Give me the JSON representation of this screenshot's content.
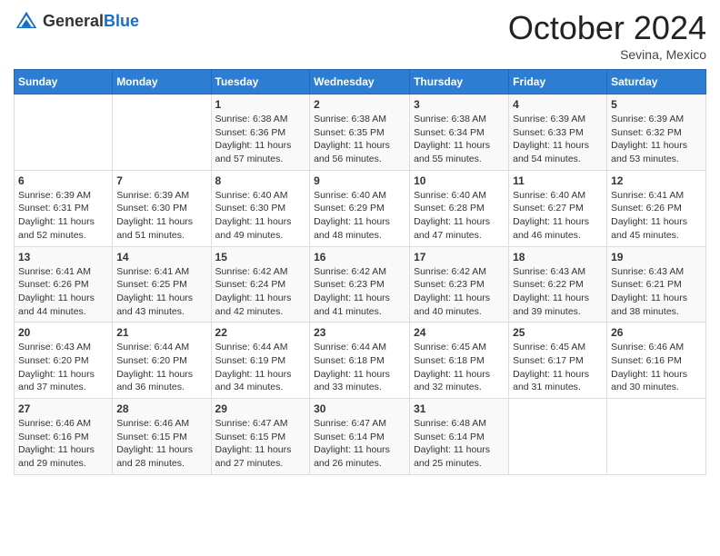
{
  "header": {
    "logo_general": "General",
    "logo_blue": "Blue",
    "month_title": "October 2024",
    "location": "Sevina, Mexico"
  },
  "days_of_week": [
    "Sunday",
    "Monday",
    "Tuesday",
    "Wednesday",
    "Thursday",
    "Friday",
    "Saturday"
  ],
  "weeks": [
    [
      {
        "day": "",
        "content": ""
      },
      {
        "day": "",
        "content": ""
      },
      {
        "day": "1",
        "content": "Sunrise: 6:38 AM\nSunset: 6:36 PM\nDaylight: 11 hours and 57 minutes."
      },
      {
        "day": "2",
        "content": "Sunrise: 6:38 AM\nSunset: 6:35 PM\nDaylight: 11 hours and 56 minutes."
      },
      {
        "day": "3",
        "content": "Sunrise: 6:38 AM\nSunset: 6:34 PM\nDaylight: 11 hours and 55 minutes."
      },
      {
        "day": "4",
        "content": "Sunrise: 6:39 AM\nSunset: 6:33 PM\nDaylight: 11 hours and 54 minutes."
      },
      {
        "day": "5",
        "content": "Sunrise: 6:39 AM\nSunset: 6:32 PM\nDaylight: 11 hours and 53 minutes."
      }
    ],
    [
      {
        "day": "6",
        "content": "Sunrise: 6:39 AM\nSunset: 6:31 PM\nDaylight: 11 hours and 52 minutes."
      },
      {
        "day": "7",
        "content": "Sunrise: 6:39 AM\nSunset: 6:30 PM\nDaylight: 11 hours and 51 minutes."
      },
      {
        "day": "8",
        "content": "Sunrise: 6:40 AM\nSunset: 6:30 PM\nDaylight: 11 hours and 49 minutes."
      },
      {
        "day": "9",
        "content": "Sunrise: 6:40 AM\nSunset: 6:29 PM\nDaylight: 11 hours and 48 minutes."
      },
      {
        "day": "10",
        "content": "Sunrise: 6:40 AM\nSunset: 6:28 PM\nDaylight: 11 hours and 47 minutes."
      },
      {
        "day": "11",
        "content": "Sunrise: 6:40 AM\nSunset: 6:27 PM\nDaylight: 11 hours and 46 minutes."
      },
      {
        "day": "12",
        "content": "Sunrise: 6:41 AM\nSunset: 6:26 PM\nDaylight: 11 hours and 45 minutes."
      }
    ],
    [
      {
        "day": "13",
        "content": "Sunrise: 6:41 AM\nSunset: 6:26 PM\nDaylight: 11 hours and 44 minutes."
      },
      {
        "day": "14",
        "content": "Sunrise: 6:41 AM\nSunset: 6:25 PM\nDaylight: 11 hours and 43 minutes."
      },
      {
        "day": "15",
        "content": "Sunrise: 6:42 AM\nSunset: 6:24 PM\nDaylight: 11 hours and 42 minutes."
      },
      {
        "day": "16",
        "content": "Sunrise: 6:42 AM\nSunset: 6:23 PM\nDaylight: 11 hours and 41 minutes."
      },
      {
        "day": "17",
        "content": "Sunrise: 6:42 AM\nSunset: 6:23 PM\nDaylight: 11 hours and 40 minutes."
      },
      {
        "day": "18",
        "content": "Sunrise: 6:43 AM\nSunset: 6:22 PM\nDaylight: 11 hours and 39 minutes."
      },
      {
        "day": "19",
        "content": "Sunrise: 6:43 AM\nSunset: 6:21 PM\nDaylight: 11 hours and 38 minutes."
      }
    ],
    [
      {
        "day": "20",
        "content": "Sunrise: 6:43 AM\nSunset: 6:20 PM\nDaylight: 11 hours and 37 minutes."
      },
      {
        "day": "21",
        "content": "Sunrise: 6:44 AM\nSunset: 6:20 PM\nDaylight: 11 hours and 36 minutes."
      },
      {
        "day": "22",
        "content": "Sunrise: 6:44 AM\nSunset: 6:19 PM\nDaylight: 11 hours and 34 minutes."
      },
      {
        "day": "23",
        "content": "Sunrise: 6:44 AM\nSunset: 6:18 PM\nDaylight: 11 hours and 33 minutes."
      },
      {
        "day": "24",
        "content": "Sunrise: 6:45 AM\nSunset: 6:18 PM\nDaylight: 11 hours and 32 minutes."
      },
      {
        "day": "25",
        "content": "Sunrise: 6:45 AM\nSunset: 6:17 PM\nDaylight: 11 hours and 31 minutes."
      },
      {
        "day": "26",
        "content": "Sunrise: 6:46 AM\nSunset: 6:16 PM\nDaylight: 11 hours and 30 minutes."
      }
    ],
    [
      {
        "day": "27",
        "content": "Sunrise: 6:46 AM\nSunset: 6:16 PM\nDaylight: 11 hours and 29 minutes."
      },
      {
        "day": "28",
        "content": "Sunrise: 6:46 AM\nSunset: 6:15 PM\nDaylight: 11 hours and 28 minutes."
      },
      {
        "day": "29",
        "content": "Sunrise: 6:47 AM\nSunset: 6:15 PM\nDaylight: 11 hours and 27 minutes."
      },
      {
        "day": "30",
        "content": "Sunrise: 6:47 AM\nSunset: 6:14 PM\nDaylight: 11 hours and 26 minutes."
      },
      {
        "day": "31",
        "content": "Sunrise: 6:48 AM\nSunset: 6:14 PM\nDaylight: 11 hours and 25 minutes."
      },
      {
        "day": "",
        "content": ""
      },
      {
        "day": "",
        "content": ""
      }
    ]
  ]
}
